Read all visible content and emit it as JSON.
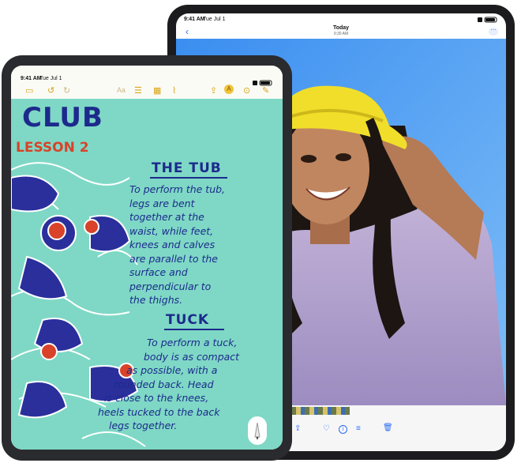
{
  "back_device": {
    "status_time": "9:41 AM",
    "status_date": "Tue Jul 1",
    "nav_title": "Today",
    "nav_subtitle": "9:30 AM",
    "more_icon": "ellipsis-circle-icon",
    "back_icon": "chevron-left-icon",
    "bottom_icons": [
      "share-icon",
      "heart-icon",
      "info-icon",
      "adjust-icon",
      "trash-icon"
    ]
  },
  "front_device": {
    "status_time": "9:41 AM",
    "status_date": "Tue Jul 1",
    "toolbar_icons": [
      "sidebar-icon",
      "undo-icon",
      "redo-icon",
      "text-format-icon",
      "checklist-icon",
      "table-icon",
      "attachment-icon",
      "share-icon",
      "markup-icon",
      "more-icon",
      "compose-icon"
    ],
    "text_format_label": "Aa",
    "note": {
      "title": "CLUB",
      "subtitle": "LESSON 2",
      "section1_heading": "THE TUB",
      "section1_lines": [
        "To perform the tub,",
        "legs are bent",
        "together at the",
        "waist, while feet,",
        "knees and calves",
        "are parallel to the",
        "surface and",
        "perpendicular to",
        "the thighs."
      ],
      "section2_heading": "TUCK",
      "section2_lines": [
        "To perform a tuck,",
        "body is as compact",
        "as possible, with a",
        "rounded back. Head",
        "is close to the knees,",
        "heels tucked to the back",
        "legs together."
      ]
    }
  },
  "colors": {
    "note_background": "#7ed8c5",
    "ink_blue": "#1d2a8c",
    "ink_red": "#d8432a",
    "accent_yellow": "#d8a418",
    "photo_sky": "#4c9cf0"
  }
}
